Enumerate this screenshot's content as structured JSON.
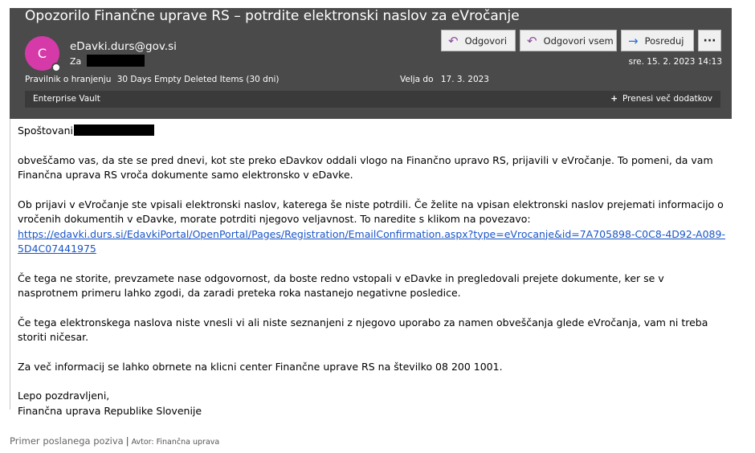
{
  "email": {
    "subject": "Opozorilo Finančne uprave RS – potrdite elektronski naslov za eVročanje",
    "avatar_letter": "C",
    "sender": "eDavki.durs@gov.si",
    "to_label": "Za",
    "policy_label": "Pravilnik o hranjenju",
    "policy_value": "30 Days Empty Deleted Items (30 dni)",
    "expires_label": "Velja do",
    "expires_value": "17. 3. 2023",
    "date": "sre. 15. 2. 2023 14:13",
    "accent_color": "#d63aa8"
  },
  "toolbar": {
    "reply_label": "Odgovori",
    "reply_all_label": "Odgovori vsem",
    "forward_label": "Posreduj",
    "more_label": "···"
  },
  "vault": {
    "label": "Enterprise Vault",
    "more_label": "Prenesi več dodatkov"
  },
  "body": {
    "greeting": "Spoštovani",
    "p1": "obveščamo vas, da ste se pred dnevi, kot ste preko eDavkov oddali vlogo na Finančno upravo RS, prijavili v eVročanje. To pomeni, da vam Finančna uprava RS vroča dokumente samo elektronsko v eDavke.",
    "p2": "Ob prijavi v eVročanje ste vpisali elektronski naslov, katerega še niste potrdili. Če želite na vpisan elektronski naslov prejemati informacijo o vročenih dokumentih v eDavke, morate potrditi njegovo veljavnost. To naredite s klikom na povezavo:",
    "link": "https://edavki.durs.si/EdavkiPortal/OpenPortal/Pages/Registration/EmailConfirmation.aspx?type=eVrocanje&id=7A705898-C0C8-4D92-A089-5D4C07441975",
    "p3": "Če tega ne storite, prevzamete nase odgovornost, da boste redno vstopali v eDavke in pregledovali prejete dokumente, ker se v nasprotnem primeru lahko zgodi, da zaradi preteka roka nastanejo negativne posledice.",
    "p4": "Če tega elektronskega naslova niste vnesli vi ali niste seznanjeni z njegovo uporabo za namen obveščanja glede eVročanja, vam ni treba storiti ničesar.",
    "p5": "Za več informacij se lahko obrnete na klicni center Finančne uprave RS na številko 08 200 1001.",
    "closing": "Lepo pozdravljeni,",
    "signature": "Finančna uprava Republike Slovenije"
  },
  "caption": {
    "text": "Primer poslanega poziva",
    "separator": "|",
    "author": "Avtor: Finančna uprava"
  }
}
